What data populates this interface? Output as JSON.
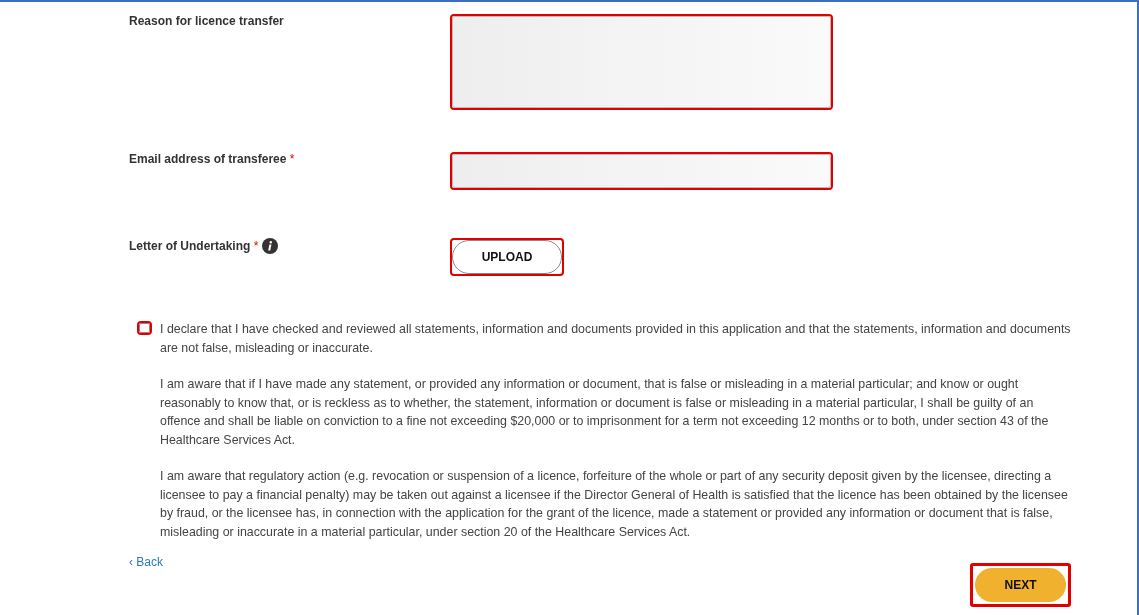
{
  "fields": [
    {
      "kind": "textarea",
      "label": "Reason for licence transfer",
      "highlighted": true
    },
    {
      "kind": "text",
      "label": "Email address of transferee",
      "required_mark": "*",
      "highlighted": true
    },
    {
      "kind": "upload",
      "label": "Letter of Undertaking",
      "required_mark": "*",
      "info": true,
      "button": "UPLOAD",
      "highlighted": true
    }
  ],
  "declaration": {
    "checked": false,
    "highlighted": true,
    "paragraphs": [
      "I declare that I have checked and reviewed all statements, information and documents provided in this application and that the statements, information and documents are not false, misleading or inaccurate.",
      "I am aware that if I have made any statement, or provided any information or document, that is false or misleading in a material particular; and know or ought reasonably to know that, or is reckless as to whether, the statement, information or document is false or misleading in a material particular, I shall be guilty of an offence and shall be liable on conviction to a fine not exceeding $20,000 or to imprisonment for a term not exceeding 12 months or to both, under section 43 of the Healthcare Services Act.",
      "I am aware that regulatory action (e.g. revocation or suspension of a licence, forfeiture of the whole or part of any security deposit given by the licensee, directing a licensee to pay a financial penalty) may be taken out against a licensee if the Director General of Health is satisfied that the licence has been obtained by the licensee by fraud, or the licensee has, in connection with the application for the grant of the licence, made a statement or provided any information or document that is false, misleading or inaccurate in a material particular, under section 20 of the Healthcare Services Act."
    ]
  },
  "navigation": {
    "back": "‹ Back",
    "next": "NEXT",
    "next_highlighted": true
  }
}
